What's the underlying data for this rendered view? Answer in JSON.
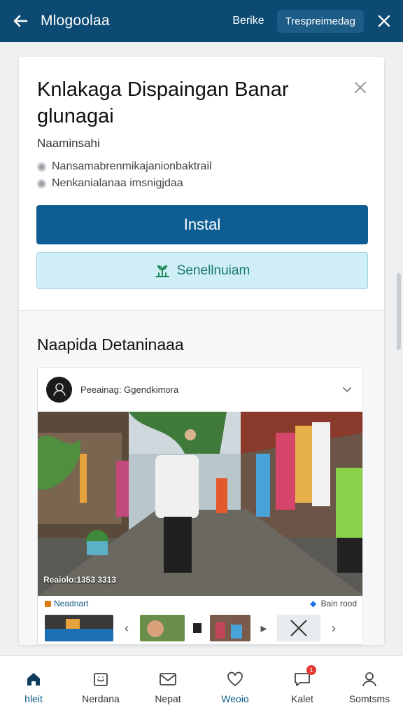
{
  "topbar": {
    "title": "Mlogoolaa",
    "link_label": "Berike",
    "chip_label": "Trespreimedag"
  },
  "card": {
    "heading": "Knlakaga Dispaingan Banar glunagai",
    "subname": "Naaminsahi",
    "bullets": [
      "Nansamabrenmikajanionbaktrail",
      "Nenkanialanaa imsnigjdaa"
    ],
    "primary_button": "Instal",
    "secondary_button": "Senellnuiam",
    "section_title": "Naapida Detaninaaa"
  },
  "post": {
    "author": "Peeainag: Ggendkimora",
    "caption": "Reaiolo:1353 3313",
    "tag_left": "Neadnart",
    "tag_right": "Bain rood"
  },
  "bottom_nav": {
    "left": [
      {
        "label": "hleit"
      },
      {
        "label": "Nerdana"
      }
    ],
    "middle": [
      {
        "label": "Nepat"
      },
      {
        "label": "Weoio"
      }
    ],
    "right": [
      {
        "label": "Kalet",
        "badge": "1"
      },
      {
        "label": "Somtsms"
      }
    ]
  },
  "colors": {
    "topbar": "#0c4a73",
    "primary": "#0f5e93",
    "secondary_bg": "#cfeef5",
    "secondary_text": "#1b7a6b",
    "badge": "#e53935"
  },
  "icons": [
    "back-arrow-icon",
    "close-icon",
    "plant-icon",
    "chevron-down-icon",
    "home-icon",
    "calendar-icon",
    "mail-icon",
    "heart-icon",
    "chat-icon",
    "person-icon"
  ]
}
